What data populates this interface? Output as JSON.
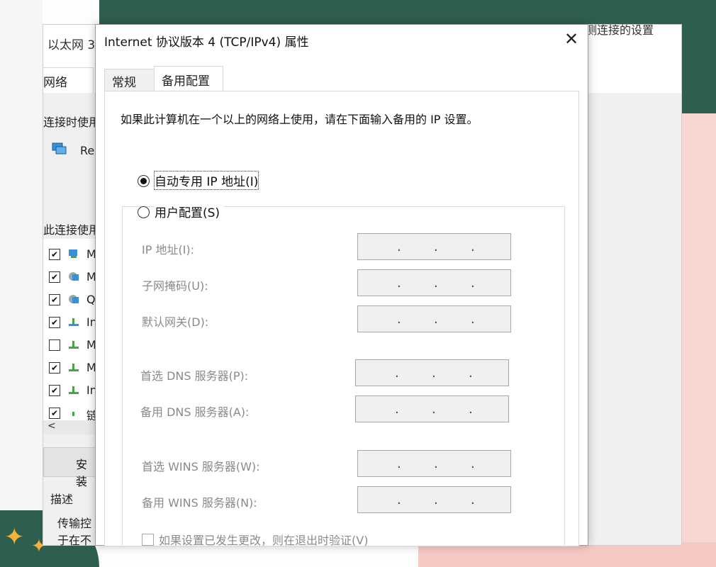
{
  "background": {
    "accent_green": "#2e5e50",
    "accent_pink": "#f7d6d2",
    "star_color": "#f2b23a"
  },
  "back_window": {
    "title": "以太网 3",
    "right_text": "测连接的设置",
    "tab": "网络",
    "connect_using_label": "连接时使用",
    "adapter_name": "Re",
    "items_label": "此连接使用",
    "items": [
      {
        "checked": true,
        "text": "M"
      },
      {
        "checked": true,
        "text": "M"
      },
      {
        "checked": true,
        "text": "Q"
      },
      {
        "checked": true,
        "text": "In"
      },
      {
        "checked": false,
        "text": "M"
      },
      {
        "checked": true,
        "text": "M"
      },
      {
        "checked": true,
        "text": "In"
      },
      {
        "checked": true,
        "text": "链"
      }
    ],
    "install_button": "安装",
    "description_label": "描述",
    "description_text_1": "传输控",
    "description_text_2": "于在不"
  },
  "dialog": {
    "title": "Internet 协议版本 4 (TCP/IPv4) 属性",
    "close_glyph": "✕",
    "tab_general": "常规",
    "tab_alternate": "备用配置",
    "description": "如果此计算机在一个以上的网络上使用，请在下面输入备用的 IP 设置。",
    "radio_auto": "自动专用 IP 地址(I)",
    "radio_user": "用户配置(S)",
    "radio_selected": "auto",
    "fields": {
      "ip_address": "IP 地址(I):",
      "subnet_mask": "子网掩码(U):",
      "default_gateway": "默认网关(D):",
      "preferred_dns": "首选 DNS 服务器(P):",
      "alternate_dns": "备用 DNS 服务器(A):",
      "preferred_wins": "首选 WINS 服务器(W):",
      "alternate_wins": "备用 WINS 服务器(N):"
    },
    "ip_dot": ".",
    "verify_label": "如果设置已发生更改，则在退出时验证(V)"
  }
}
